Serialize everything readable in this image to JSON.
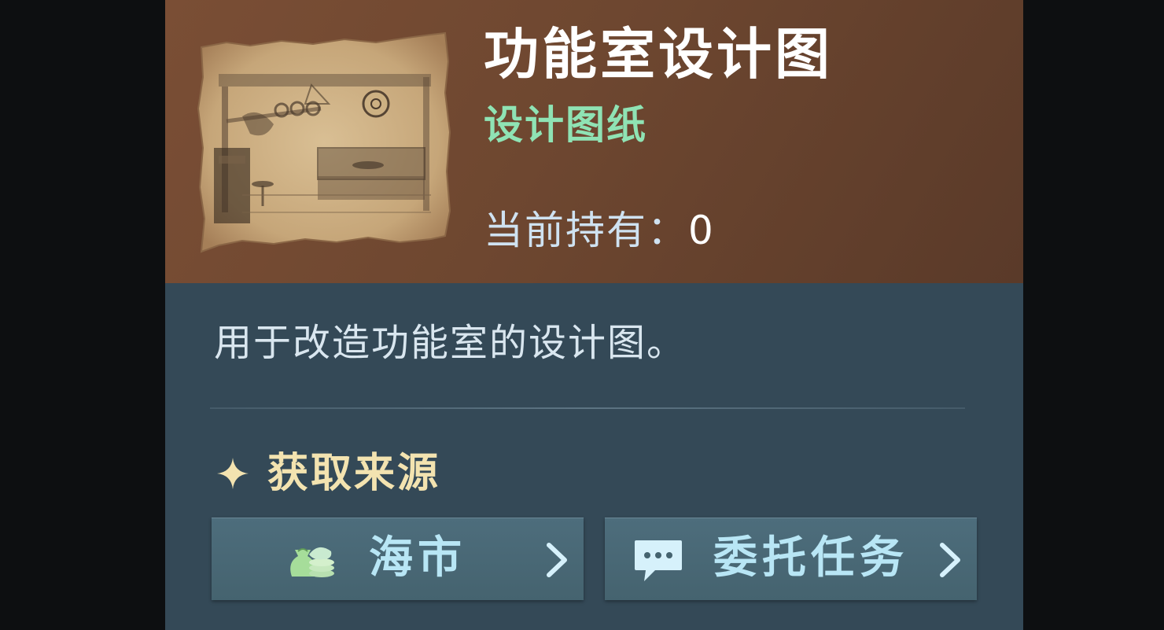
{
  "item": {
    "title": "功能室设计图",
    "category": "设计图纸",
    "owned_label": "当前持有：",
    "owned_count": "0",
    "description": "用于改造功能室的设计图。",
    "thumbnail_icon": "blueprint-sketch-image"
  },
  "sources": {
    "heading": "获取来源",
    "heading_icon": "sparkle-icon",
    "items": [
      {
        "label": "海市",
        "icon": "money-bags-icon"
      },
      {
        "label": "委托任务",
        "icon": "chat-bubble-icon"
      }
    ]
  },
  "colors": {
    "header_bg": "#6e4730",
    "panel_bg": "#344957",
    "title": "#ffffff",
    "category": "#8fe3b4",
    "heading": "#f3e3b0",
    "button_bg": "#4a6a78",
    "button_text": "#b8e6f5"
  }
}
